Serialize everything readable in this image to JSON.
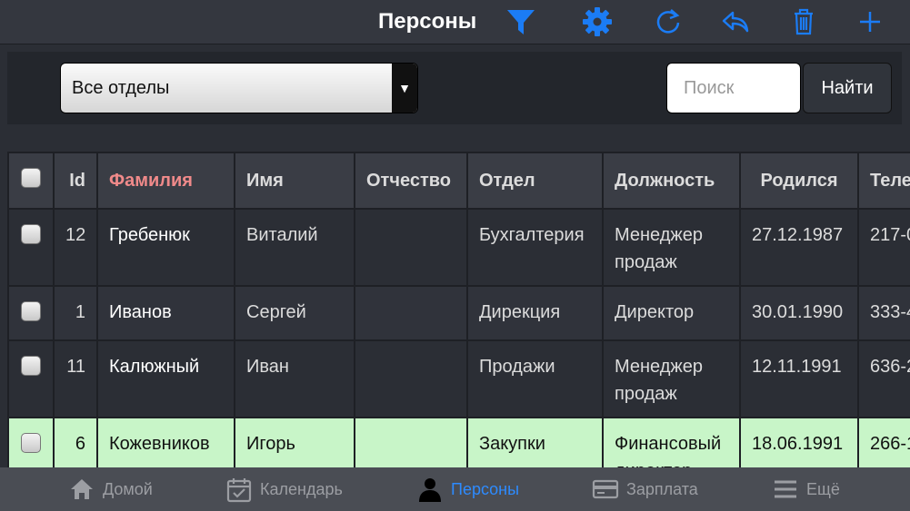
{
  "header": {
    "title": "Персоны",
    "icons": [
      "filter-icon",
      "settings-icon",
      "refresh-icon",
      "reply-icon",
      "trash-icon",
      "add-icon"
    ],
    "accent": "#1b7cf5"
  },
  "filter": {
    "department_select": "Все отделы",
    "search_placeholder": "Поиск",
    "find_label": "Найти"
  },
  "table": {
    "columns": [
      "Id",
      "Фамилия",
      "Имя",
      "Отчество",
      "Отдел",
      "Должность",
      "Родился",
      "Теле"
    ],
    "sorted_column": "Фамилия",
    "rows": [
      {
        "id": "12",
        "last": "Гребенюк",
        "first": "Виталий",
        "middle": "",
        "dept": "Бухгалтерия",
        "position": "Менеджер продаж",
        "born": "27.12.1987",
        "phone": "217-0"
      },
      {
        "id": "1",
        "last": "Иванов",
        "first": "Сергей",
        "middle": "",
        "dept": "Дирекция",
        "position": "Директор",
        "born": "30.01.1990",
        "phone": "333-4"
      },
      {
        "id": "11",
        "last": "Калюжный",
        "first": "Иван",
        "middle": "",
        "dept": "Продажи",
        "position": "Менеджер продаж",
        "born": "12.11.1991",
        "phone": "636-2"
      },
      {
        "id": "6",
        "last": "Кожевников",
        "first": "Игорь",
        "middle": "",
        "dept": "Закупки",
        "position": "Финансовый директор",
        "born": "18.06.1991",
        "phone": "266-1"
      }
    ],
    "highlight_color": "#c8f5c8"
  },
  "tabbar": {
    "tabs": [
      {
        "label": "Домой",
        "icon": "home-icon"
      },
      {
        "label": "Календарь",
        "icon": "calendar-icon"
      },
      {
        "label": "Персоны",
        "icon": "person-icon",
        "active": true
      },
      {
        "label": "Зарплата",
        "icon": "card-icon"
      },
      {
        "label": "Ещё",
        "icon": "menu-icon"
      }
    ]
  }
}
